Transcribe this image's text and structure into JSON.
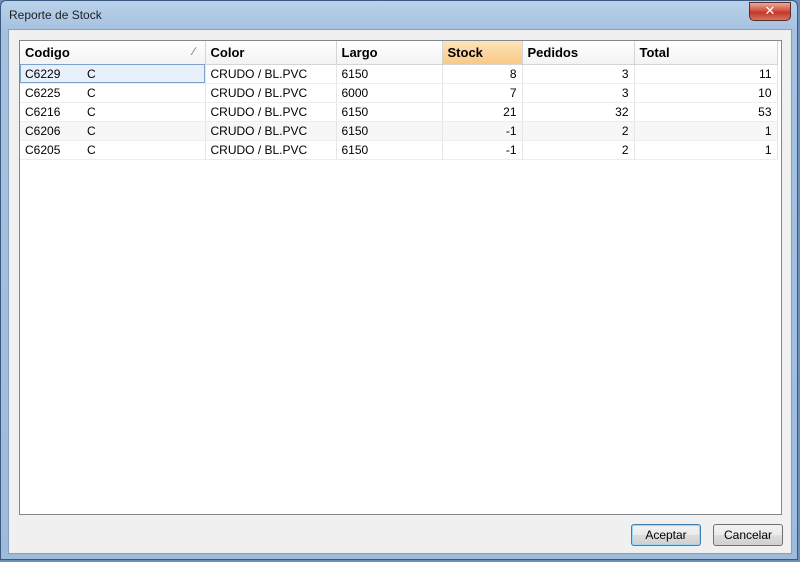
{
  "window": {
    "title": "Reporte de Stock",
    "close_label": "✕"
  },
  "table": {
    "columns": [
      "Codigo",
      "Color",
      "Largo",
      "Stock",
      "Pedidos",
      "Total"
    ],
    "rows": [
      {
        "code": "C6229",
        "suffix": "C",
        "color": "CRUDO / BL.PVC",
        "largo": "6150",
        "stock": "8",
        "pedidos": "3",
        "total": "11"
      },
      {
        "code": "C6225",
        "suffix": "C",
        "color": "CRUDO / BL.PVC",
        "largo": "6000",
        "stock": "7",
        "pedidos": "3",
        "total": "10"
      },
      {
        "code": "C6216",
        "suffix": "C",
        "color": "CRUDO / BL.PVC",
        "largo": "6150",
        "stock": "21",
        "pedidos": "32",
        "total": "53"
      },
      {
        "code": "C6206",
        "suffix": "C",
        "color": "CRUDO / BL.PVC",
        "largo": "6150",
        "stock": "-1",
        "pedidos": "2",
        "total": "1"
      },
      {
        "code": "C6205",
        "suffix": "C",
        "color": "CRUDO / BL.PVC",
        "largo": "6150",
        "stock": "-1",
        "pedidos": "2",
        "total": "1"
      }
    ]
  },
  "buttons": {
    "accept": "Aceptar",
    "cancel": "Cancelar"
  }
}
